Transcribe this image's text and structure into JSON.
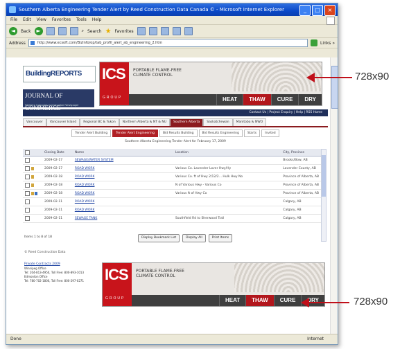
{
  "window": {
    "title": "Southern Alberta Engineering Tender Alert by Reed Construction Data Canada © - Microsoft Internet Explorer",
    "menu": [
      "File",
      "Edit",
      "View",
      "Favorites",
      "Tools",
      "Help"
    ],
    "toolbar": {
      "back": "Back",
      "search": "Search",
      "favorites": "Favorites"
    },
    "address_label": "Address",
    "address": "http://www.ecsoft.com/BizInfo/op/tab_profil_alert_ab_engineering_2.htm",
    "status_left": "Done",
    "status_right": "Internet"
  },
  "header": {
    "logo_building": "BuildingREPORTS",
    "logo_joc": "JOURNAL OF COMMERCE",
    "logo_joc_sub": "Western Canada's Construction Newspaper"
  },
  "banner": {
    "brand": "ICS",
    "group": "GROUP",
    "tagline_1": "PORTABLE FLAME-FREE",
    "tagline_2": "CLIMATE CONTROL",
    "words": [
      "HEAT",
      "THAW",
      "CURE",
      "DRY"
    ]
  },
  "contactbar": "Contact Us | Project Enquiry | Help | RSS Home",
  "region_tabs": [
    {
      "label": "Vancouver",
      "active": false
    },
    {
      "label": "Vancouver Island",
      "active": false
    },
    {
      "label": "Regional BC & Yukon",
      "active": false
    },
    {
      "label": "Northern Alberta & NT & NU",
      "active": false
    },
    {
      "label": "Southern Alberta",
      "active": true
    },
    {
      "label": "Saskatchewan",
      "active": false
    },
    {
      "label": "Manitoba & NWO",
      "active": false
    }
  ],
  "sub_tabs": [
    {
      "label": "Tender Alert Building",
      "active": false
    },
    {
      "label": "Tender Alert Engineering",
      "active": true
    },
    {
      "label": "Bid Results Building",
      "active": false
    },
    {
      "label": "Bid Results Engineering",
      "active": false
    },
    {
      "label": "Starts",
      "active": false
    },
    {
      "label": "Invited",
      "active": false
    }
  ],
  "table_caption": "Southern Alberta Engineering Tender Alert for February 17, 2009",
  "grid": {
    "columns": [
      "Closing Date",
      "Name",
      "Location",
      "City, Province"
    ],
    "rows": [
      {
        "date": "2009-02-17",
        "name": "SEWAGE/WATER SYSTEM",
        "location": "",
        "city": "Brooks/Bow, AB",
        "doc": false,
        "pdf": false
      },
      {
        "date": "2009-02-17",
        "name": "ROAD WORK",
        "location": "Various Co. Lavender Lover Hwy/Hy",
        "city": "Lavender County, AB",
        "doc": true,
        "pdf": false
      },
      {
        "date": "2009-02-18",
        "name": "ROAD WORK",
        "location": "Various Co. ft of Hwy 2/12/2... Hulk Hwy No",
        "city": "Province of Alberta, AB",
        "doc": true,
        "pdf": false
      },
      {
        "date": "2009-02-18",
        "name": "ROAD WORK",
        "location": "N of Various Hwy - Various Co",
        "city": "Province of Alberta, AB",
        "doc": true,
        "pdf": false
      },
      {
        "date": "2009-02-18",
        "name": "ROAD WORK",
        "location": "Various ft of Hwy Co",
        "city": "Province of Alberta, AB",
        "doc": true,
        "pdf": true
      },
      {
        "date": "2009-02-11",
        "name": "ROAD WORK",
        "location": "",
        "city": "Calgary, AB",
        "doc": false,
        "pdf": false
      },
      {
        "date": "2009-02-11",
        "name": "ROAD WORK",
        "location": "",
        "city": "Calgary, AB",
        "doc": false,
        "pdf": false
      },
      {
        "date": "2009-02-11",
        "name": "SEWAGE TANK",
        "location": "Southfield Rd to Sherwood Trail",
        "city": "Calgary, AB",
        "doc": false,
        "pdf": false
      }
    ]
  },
  "items_note": "Items 1 to 8 of 18",
  "buttons": [
    "Display Bookmark List",
    "Display All",
    "Print Items"
  ],
  "copyright": "© Reed Construction Data",
  "contact": {
    "name": "Private Contracts 2009",
    "lines": [
      "Winnipeg Office",
      "Tel: 204-813-4950, Toll Free: 800-893-1013",
      "Edmonton Office",
      "Tel: 780-702-1800, Toll Free: 800-297-0271"
    ]
  },
  "annotations": [
    "728x90",
    "728x90"
  ],
  "colors": {
    "accent_red": "#b2161c",
    "nav_blue": "#1f2f5a",
    "annotation": "#c0101a"
  }
}
